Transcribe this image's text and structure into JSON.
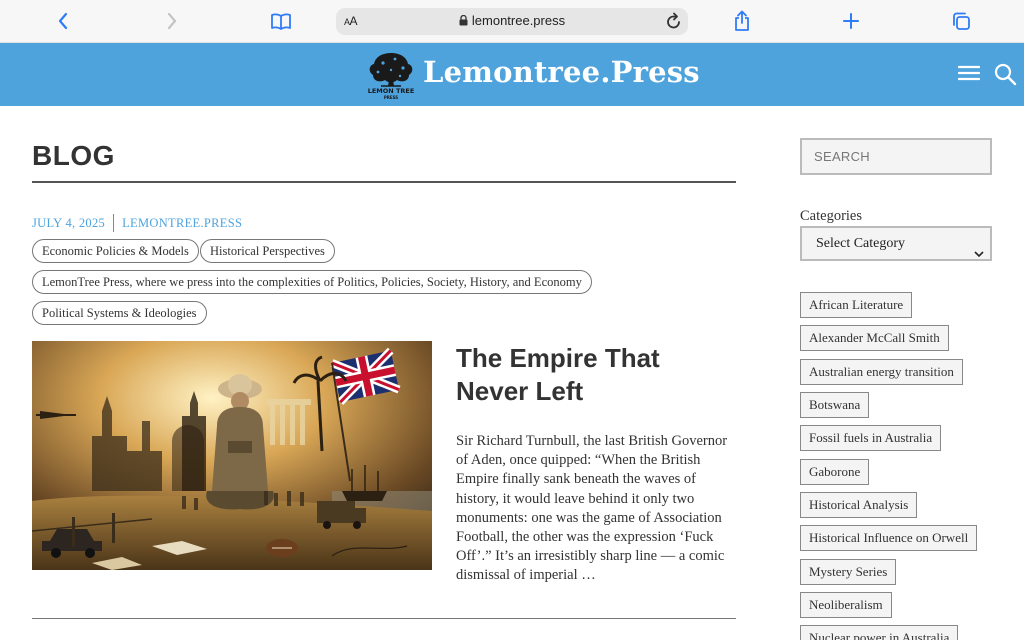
{
  "browser": {
    "aa_label_small": "A",
    "aa_label": "A",
    "url": "lemontree.press"
  },
  "site": {
    "logo_text_1": "LEMON TREE",
    "logo_text_2": "PRESS",
    "title": "Lemontree.Press"
  },
  "main": {
    "page_title": "BLOG",
    "post": {
      "date": "JULY 4, 2025",
      "author": "LEMONTREE.PRESS",
      "tags": [
        "Economic Policies & Models",
        "Historical Perspectives",
        "LemonTree Press, where we press into the complexities of Politics, Policies, Society, History, and Economy",
        "Political Systems & Ideologies"
      ],
      "title_line1": "The Empire That",
      "title_line2": "Never Left",
      "excerpt": "Sir Richard Turnbull, the last British Governor of Aden, once quipped: “When the British Empire finally sank beneath the waves of history, it would leave behind it only two monuments: one was the game of Association Football, the other was the expression ‘Fuck Off’.” It’s an irresistibly sharp line — a comic dismissal of imperial …"
    }
  },
  "sidebar": {
    "search_placeholder": "SEARCH",
    "categories_heading": "Categories",
    "select_value": "Select Category",
    "tags": [
      "African Literature",
      "Alexander McCall Smith",
      "Australian energy transition",
      "Botswana",
      "Fossil fuels in Australia",
      "Gaborone",
      "Historical Analysis",
      "Historical Influence on Orwell",
      "Mystery Series",
      "Neoliberalism",
      "Nuclear power in Australia"
    ]
  },
  "colors": {
    "header_blue": "#4ea3dd",
    "link_blue": "#4ea3dd",
    "ios_blue": "#2f7cf6"
  },
  "icons": [
    "back-icon",
    "forward-icon",
    "bookmarks-icon",
    "lock-icon",
    "reload-icon",
    "share-icon",
    "new-tab-icon",
    "tabs-icon",
    "menu-icon",
    "search-icon",
    "chevron-down-icon"
  ]
}
